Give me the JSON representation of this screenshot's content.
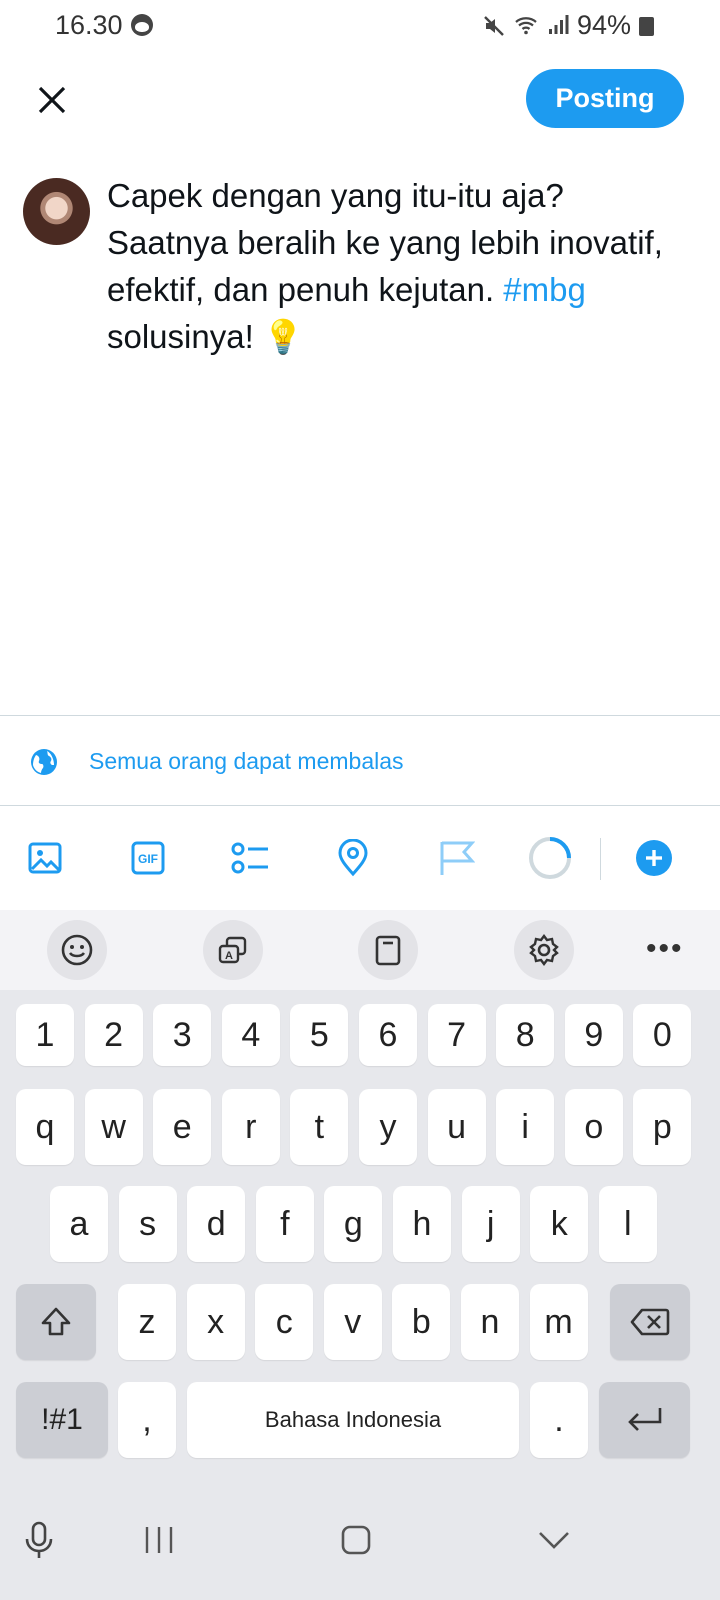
{
  "status_bar": {
    "time": "16.30",
    "battery_pct": "94%",
    "icons": [
      "mute-icon",
      "wifi-icon",
      "signal-icon",
      "battery-icon"
    ]
  },
  "header": {
    "close_icon": "close-icon",
    "post_label": "Posting",
    "accent": "#1d9bf0"
  },
  "compose": {
    "text_before_hashtag": "Capek dengan yang itu-itu aja? Saatnya beralih ke yang lebih inovatif, efektif, dan penuh kejutan.",
    "hashtag": "#mbg",
    "text_after_hashtag": " solusinya! 💡"
  },
  "reply_setting": {
    "icon": "globe-icon",
    "label": "Semua orang dapat membalas"
  },
  "toolbar": {
    "items": [
      "image-icon",
      "gif-icon",
      "poll-icon",
      "location-icon",
      "flag-icon",
      "character-counter",
      "add-thread-icon"
    ]
  },
  "keyboard": {
    "toolbar": [
      "emoji-icon",
      "translate-icon",
      "clipboard-icon",
      "settings-icon",
      "more-icon"
    ],
    "number_row": [
      "1",
      "2",
      "3",
      "4",
      "5",
      "6",
      "7",
      "8",
      "9",
      "0"
    ],
    "row1": [
      "q",
      "w",
      "e",
      "r",
      "t",
      "y",
      "u",
      "i",
      "o",
      "p"
    ],
    "row2": [
      "a",
      "s",
      "d",
      "f",
      "g",
      "h",
      "j",
      "k",
      "l"
    ],
    "row3": [
      "z",
      "x",
      "c",
      "v",
      "b",
      "n",
      "m"
    ],
    "symbols_label": "!#1",
    "comma_label": ",",
    "space_label": "Bahasa Indonesia",
    "period_label": "."
  },
  "navbar": {
    "items": [
      "mic-icon",
      "recent-apps-icon",
      "home-icon",
      "hide-keyboard-icon"
    ]
  }
}
